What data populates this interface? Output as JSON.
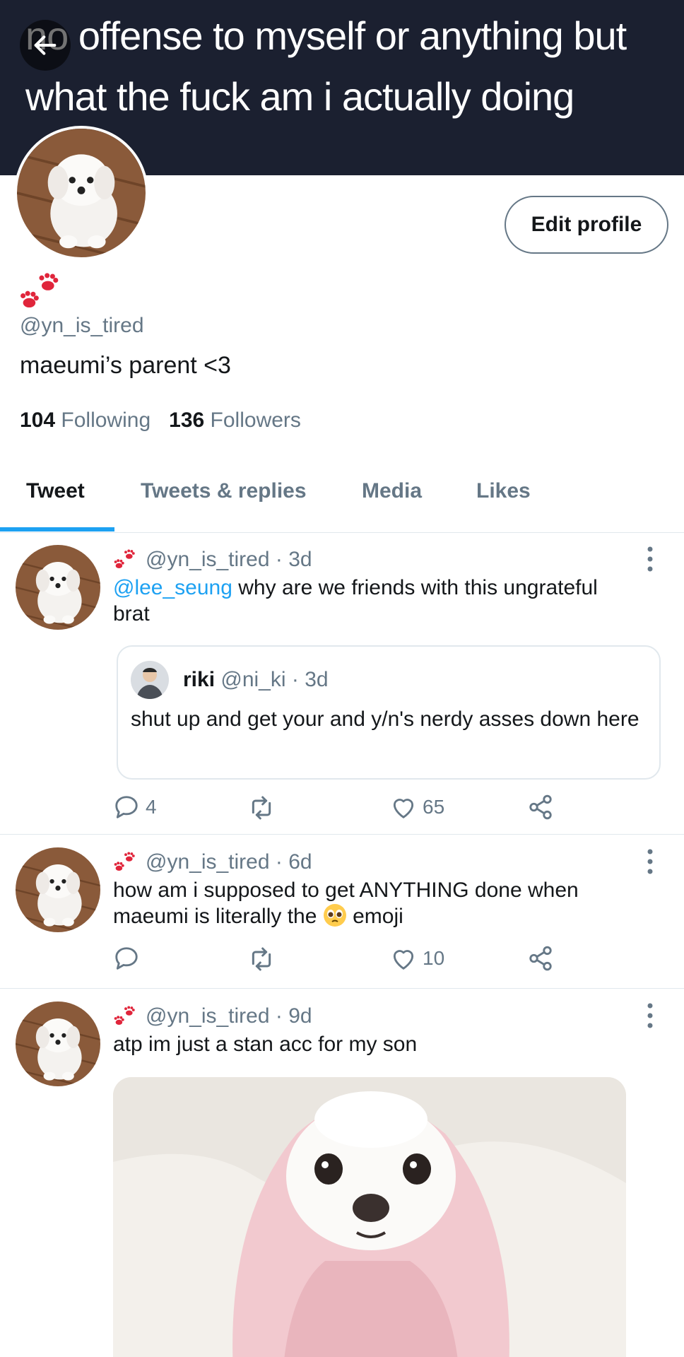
{
  "banner": {
    "text": "no offense to myself or anything but what the fuck am i actually doing"
  },
  "profile": {
    "edit_button": "Edit profile",
    "handle": "@yn_is_tired",
    "bio": "maeumi’s parent <3",
    "following_count": "104",
    "following_label": "Following",
    "followers_count": "136",
    "followers_label": "Followers"
  },
  "tabs": [
    {
      "label": "Tweet",
      "active": true
    },
    {
      "label": "Tweets & replies"
    },
    {
      "label": "Media"
    },
    {
      "label": "Likes"
    }
  ],
  "tweets": [
    {
      "handle": "@yn_is_tired",
      "time": "· 3d",
      "mention": "@lee_seung",
      "text": " why are we friends with this ungrateful brat",
      "quote": {
        "name": "riki",
        "handle": "@ni_ki",
        "time": "· 3d",
        "text": "shut up and get your and y/n's nerdy asses down here"
      },
      "replies": "4",
      "retweets": "",
      "likes": "65"
    },
    {
      "handle": "@yn_is_tired",
      "time": "· 6d",
      "text_before": "how am i supposed to get ANYTHING done when maeumi is literally the ",
      "text_after": " emoji",
      "replies": "",
      "retweets": "",
      "likes": "10"
    },
    {
      "handle": "@yn_is_tired",
      "time": "· 9d",
      "text": "atp im just a stan acc for my son"
    }
  ],
  "colors": {
    "accent": "#1da1f2",
    "muted": "#657786",
    "banner": "#1b2030",
    "paw": "#e0253b"
  }
}
